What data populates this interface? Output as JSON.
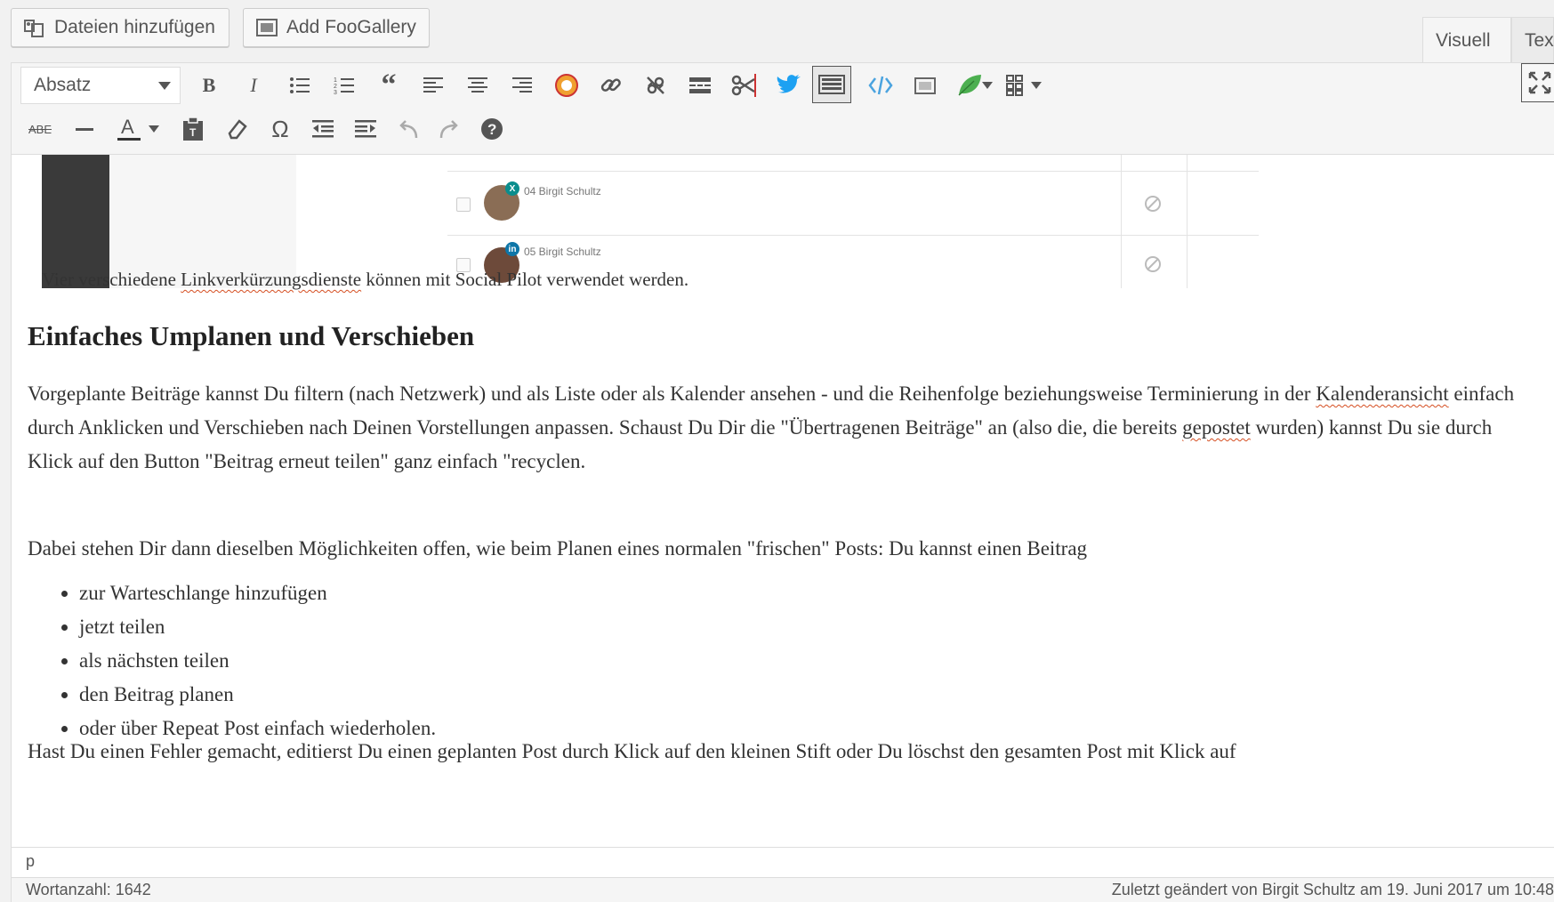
{
  "media_buttons": {
    "add_files": "Dateien hinzufügen",
    "add_foogallery": "Add FooGallery"
  },
  "tabs": {
    "visual": "Visuell",
    "text": "Tex"
  },
  "toolbar": {
    "format_select": "Absatz"
  },
  "embedded_screenshot": {
    "rows": [
      {
        "account": "04 Birgit Schultz",
        "network": "xing"
      },
      {
        "account": "05 Birgit Schultz",
        "network": "linkedin"
      }
    ]
  },
  "content": {
    "caption": {
      "before": "Vier verschiedene ",
      "link": "Linkverkürzungsdienste",
      "after": " können mit Social Pilot verwendet werden."
    },
    "heading": "Einfaches Umplanen und Verschieben",
    "p1": {
      "a": "Vorgeplante Beiträge kannst Du filtern (nach Netzwerk) und als Liste oder als Kalender ansehen - und die Reihenfolge beziehungsweise Terminierung in der ",
      "b": "Kalenderansicht",
      "c": " einfach durch Anklicken und Verschieben nach Deinen Vorstellungen anpassen. Schaust Du Dir die \"Übertragenen Beiträge\" an (also die, die bereits ",
      "d": "gepostet",
      "e": " wurden) kannst Du sie durch Klick auf den Button \"Beitrag erneut teilen\" ganz einfach \"recyclen."
    },
    "p2": "Dabei stehen Dir dann dieselben Möglichkeiten offen, wie beim Planen eines normalen \"frischen\" Posts: Du kannst einen Beitrag",
    "list": [
      "zur Warteschlange hinzufügen",
      "jetzt teilen",
      "als nächsten teilen",
      "den Beitrag planen",
      "oder über Repeat Post einfach wiederholen."
    ],
    "cut_line": "Hast Du einen Fehler gemacht, editierst Du einen geplanten Post durch Klick auf den kleinen Stift oder Du löschst den gesamten Post mit Klick auf"
  },
  "path": "p",
  "status": {
    "word_count": "Wortanzahl: 1642",
    "last_modified": "Zuletzt geändert von Birgit Schultz am 19. Juni 2017 um 10:48"
  }
}
